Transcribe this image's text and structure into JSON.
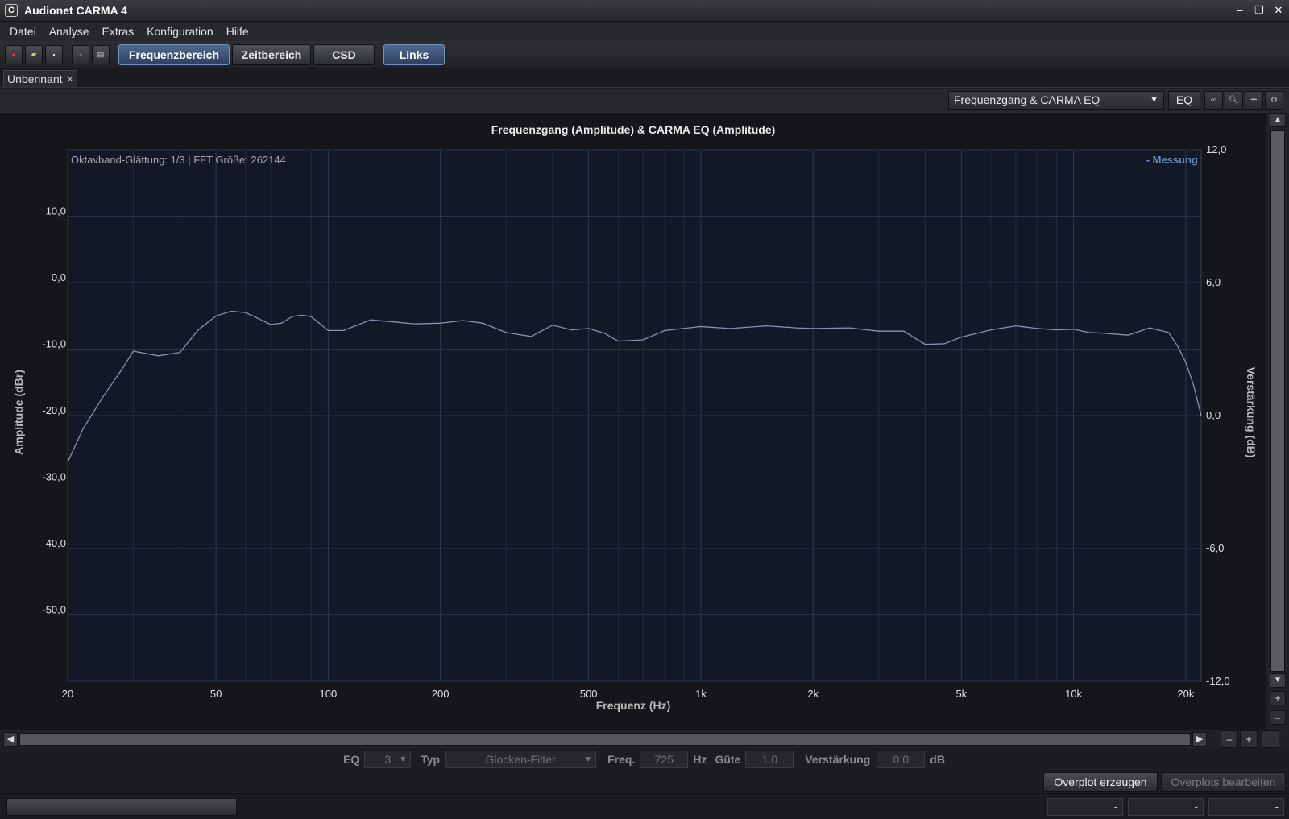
{
  "window": {
    "title": "Audionet CARMA 4",
    "app_icon": "C"
  },
  "menu": [
    {
      "label": "Datei"
    },
    {
      "label": "Analyse"
    },
    {
      "label": "Extras"
    },
    {
      "label": "Konfiguration"
    },
    {
      "label": "Hilfe"
    }
  ],
  "toolbar": {
    "buttons": [
      {
        "label": "Frequenzbereich",
        "active": true
      },
      {
        "label": "Zeitbereich",
        "active": false
      },
      {
        "label": "CSD",
        "active": false
      },
      {
        "label": "Links",
        "active": true
      }
    ]
  },
  "tab": {
    "label": "Unbennant",
    "close": "×"
  },
  "viewbar": {
    "view_select": "Frequenzgang & CARMA EQ",
    "eq_button": "EQ"
  },
  "chart_data": {
    "type": "line",
    "title": "Frequenzgang (Amplitude) & CARMA EQ (Amplitude)",
    "info": "Oktavband-Glättung: 1/3 | FFT Größe: 262144",
    "legend": "- Messung",
    "legend_placement": "top-right",
    "xlabel": "Frequenz (Hz)",
    "ylabel": "Amplitude (dBr)",
    "y2label": "Verstärkung (dB)",
    "x_scale": "log",
    "xlim": [
      20,
      22000
    ],
    "ylim": [
      -60,
      20
    ],
    "y2lim": [
      -12,
      12
    ],
    "grid": true,
    "xticks": [
      {
        "value": 20,
        "label": "20"
      },
      {
        "value": 50,
        "label": "50"
      },
      {
        "value": 100,
        "label": "100"
      },
      {
        "value": 200,
        "label": "200"
      },
      {
        "value": 500,
        "label": "500"
      },
      {
        "value": 1000,
        "label": "1k"
      },
      {
        "value": 2000,
        "label": "2k"
      },
      {
        "value": 5000,
        "label": "5k"
      },
      {
        "value": 10000,
        "label": "10k"
      },
      {
        "value": 20000,
        "label": "20k"
      }
    ],
    "yticks": [
      {
        "value": 10,
        "label": "10,0"
      },
      {
        "value": 0,
        "label": "0,0"
      },
      {
        "value": -10,
        "label": "-10,0"
      },
      {
        "value": -20,
        "label": "-20,0"
      },
      {
        "value": -30,
        "label": "-30,0"
      },
      {
        "value": -40,
        "label": "-40,0"
      },
      {
        "value": -50,
        "label": "-50,0"
      }
    ],
    "y2ticks": [
      {
        "value": 12,
        "label": "12,0"
      },
      {
        "value": 6,
        "label": "6,0"
      },
      {
        "value": 0,
        "label": "0,0"
      },
      {
        "value": -6,
        "label": "-6,0"
      },
      {
        "value": -12,
        "label": "-12,0"
      }
    ],
    "series": [
      {
        "name": "Messung",
        "color": "#8a93ad",
        "x": [
          20,
          22,
          25,
          28,
          30,
          35,
          40,
          45,
          50,
          55,
          60,
          65,
          70,
          75,
          80,
          85,
          90,
          100,
          110,
          130,
          150,
          170,
          200,
          230,
          260,
          300,
          350,
          400,
          450,
          500,
          550,
          600,
          700,
          800,
          1000,
          1200,
          1500,
          1800,
          2000,
          2500,
          3000,
          3500,
          4000,
          4500,
          5000,
          6000,
          7000,
          8000,
          9000,
          10000,
          11000,
          12000,
          14000,
          16000,
          18000,
          19000,
          20000,
          21000,
          22000
        ],
        "y": [
          -27,
          -22,
          -17,
          -13,
          -10.3,
          -11,
          -10.5,
          -7,
          -5,
          -4.3,
          -4.5,
          -5.4,
          -6.3,
          -6.1,
          -5.1,
          -4.9,
          -5.1,
          -7.2,
          -7.2,
          -5.6,
          -5.9,
          -6.2,
          -6.1,
          -5.7,
          -6.1,
          -7.5,
          -8.1,
          -6.4,
          -7.1,
          -6.9,
          -7.6,
          -8.8,
          -8.6,
          -7.2,
          -6.6,
          -6.9,
          -6.5,
          -6.8,
          -6.9,
          -6.8,
          -7.3,
          -7.3,
          -9.3,
          -9.2,
          -8.2,
          -7.1,
          -6.5,
          -6.9,
          -7.1,
          -7,
          -7.5,
          -7.6,
          -7.9,
          -6.8,
          -7.5,
          -9.5,
          -12,
          -15.5,
          -20
        ]
      }
    ]
  },
  "eq_controls": {
    "eq_label": "EQ",
    "eq_value": "3",
    "typ_label": "Typ",
    "typ_value": "Glocken-Filter",
    "freq_label": "Freq.",
    "freq_value": "725",
    "freq_unit": "Hz",
    "guete_label": "Güte",
    "guete_value": "1.0",
    "gain_label": "Verstärkung",
    "gain_value": "0.0",
    "gain_unit": "dB"
  },
  "overplot": {
    "create_label": "Overplot erzeugen",
    "edit_label": "Overplots bearbeiten"
  },
  "status": {
    "cells": [
      "-",
      "-",
      "-"
    ]
  },
  "colors": {
    "accent": "#6f90c0",
    "plot_bg": "#121826",
    "curve": "#8a93ad"
  }
}
